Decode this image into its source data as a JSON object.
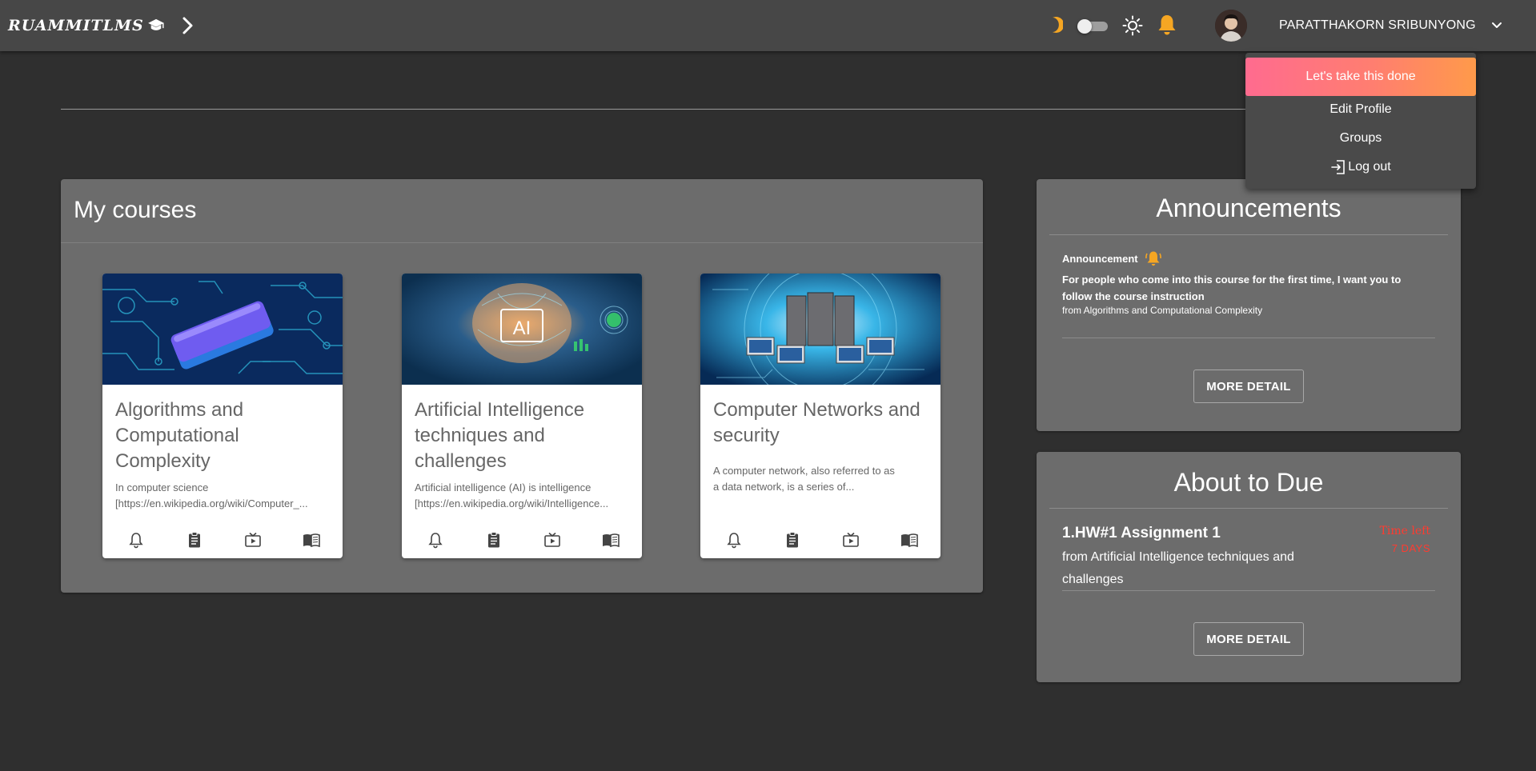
{
  "header": {
    "logo_text": "RUAMMITLMS",
    "user_name": "PARATTHAKORN SRIBUNYONG",
    "dark_mode_on": false
  },
  "dropdown": {
    "cta_label": "Let's take this done",
    "edit_profile": "Edit Profile",
    "groups": "Groups",
    "logout": "Log out"
  },
  "courses": {
    "title": "My courses",
    "items": [
      {
        "title": "Algorithms and Computational Complexity",
        "desc_line1": "In computer science",
        "desc_line2": "[https://en.wikipedia.org/wiki/Computer_..."
      },
      {
        "title": "Artificial Intelligence techniques and challenges",
        "desc_line1": "Artificial intelligence (AI) is intelligence",
        "desc_line2": "[https://en.wikipedia.org/wiki/Intelligence..."
      },
      {
        "title": "Computer Networks and security",
        "desc_line1": "A computer network, also referred to as",
        "desc_line2": "a data network, is a series of..."
      }
    ]
  },
  "announcements": {
    "title": "Announcements",
    "label": "Announcement",
    "text": "For people who come into this course for the first time, I want you to follow the course instruction",
    "from": "from Algorithms and Computational Complexity",
    "button": "MORE DETAIL"
  },
  "due": {
    "title": "About to Due",
    "item_title": "1.HW#1 Assignment 1",
    "item_from": "from Artificial Intelligence techniques and challenges",
    "time_left_label": "Time left",
    "time_left_value": "7 DAYS",
    "button": "MORE DETAIL"
  },
  "colors": {
    "accent_orange": "#f5a623",
    "due_red": "#ff3b30",
    "cta_gradient_start": "#ff6b8f",
    "cta_gradient_end": "#ff9a4a"
  }
}
